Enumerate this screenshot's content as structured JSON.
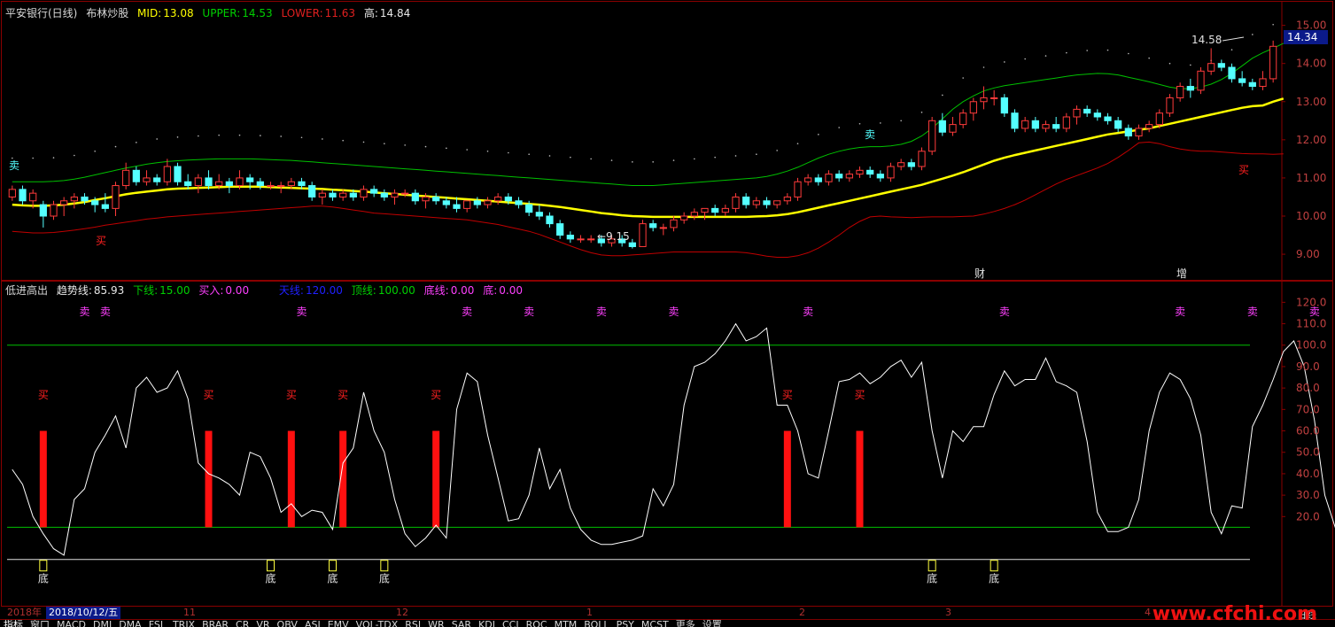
{
  "header_top": {
    "stock": "平安银行(日线)",
    "indicator": "布林炒股",
    "mid_label": "MID:",
    "mid": "13.08",
    "upper_label": "UPPER:",
    "upper": "14.53",
    "lower_label": "LOWER:",
    "lower": "11.63",
    "high_label": "高:",
    "high": "14.84"
  },
  "header_sub": {
    "indicator": "低进高出",
    "trend_label": "趋势线:",
    "trend": "85.93",
    "down_label": "下线:",
    "down": "15.00",
    "buy_label": "买入:",
    "buy": "0.00",
    "sky_label": "天线:",
    "sky": "120.00",
    "top_label": "顶线:",
    "top": "100.00",
    "floor_label": "底线:",
    "floor": "0.00",
    "bottom_label": "底:",
    "bottom": "0.00"
  },
  "price_axis": [
    "15.00",
    "14.00",
    "13.00",
    "12.00",
    "11.00",
    "10.00",
    "9.00"
  ],
  "osc_axis": [
    "120.0",
    "110.0",
    "100.0",
    "90.0",
    "80.0",
    "70.0",
    "60.0",
    "50.0",
    "40.0",
    "30.0",
    "20.0"
  ],
  "current_price": "14.34",
  "annotations": {
    "high_mark": "14.58",
    "low_mark": "9.15",
    "cai": "财",
    "zeng": "增"
  },
  "signal_labels": {
    "sell": "卖",
    "buy": "买",
    "bottom": "底"
  },
  "date_axis": {
    "year": "2018年",
    "cursor_date": "2018/10/12/五",
    "months": [
      "11",
      "12",
      "1",
      "2",
      "3",
      "4"
    ],
    "period": "日线"
  },
  "tabs": [
    "指标",
    "窗口",
    "MACD",
    "DMI",
    "DMA",
    "FSL",
    "TRIX",
    "BRAR",
    "CR",
    "VR",
    "OBV",
    "ASI",
    "EMV",
    "VOL-TDX",
    "RSI",
    "WR",
    "SAR",
    "KDJ",
    "CCI",
    "ROC",
    "MTM",
    "BOLL",
    "PSY",
    "MCST",
    "更多",
    "设置"
  ],
  "watermark": "www.cfchi.com",
  "colors": {
    "up": "#ff3b3b",
    "down": "#54ffff",
    "mid_line": "#ffff00",
    "upper_line": "#00c000",
    "lower_line": "#c00000",
    "osc_line": "#ffffff",
    "ref_line": "#00c000",
    "border": "#8a0000",
    "sell": "#ff40ff",
    "buy": "#ff2020"
  },
  "chart_data": {
    "type": "candlestick+line",
    "price_range": [
      8.7,
      15.2
    ],
    "osc_range": [
      -15,
      128
    ],
    "candles": [
      [
        10.5,
        10.8,
        10.4,
        10.7
      ],
      [
        10.7,
        10.8,
        10.3,
        10.4
      ],
      [
        10.4,
        10.7,
        10.2,
        10.6
      ],
      [
        10.3,
        10.4,
        9.7,
        10.0
      ],
      [
        10.0,
        10.4,
        9.9,
        10.3
      ],
      [
        10.3,
        10.5,
        10.0,
        10.4
      ],
      [
        10.4,
        10.6,
        10.2,
        10.5
      ],
      [
        10.5,
        10.6,
        10.3,
        10.4
      ],
      [
        10.4,
        10.5,
        10.1,
        10.3
      ],
      [
        10.3,
        10.6,
        10.1,
        10.2
      ],
      [
        10.2,
        10.9,
        10.0,
        10.8
      ],
      [
        10.8,
        11.4,
        10.7,
        11.2
      ],
      [
        11.2,
        11.3,
        10.8,
        10.9
      ],
      [
        10.9,
        11.2,
        10.8,
        11.0
      ],
      [
        11.0,
        11.1,
        10.8,
        10.9
      ],
      [
        10.9,
        11.5,
        10.8,
        11.3
      ],
      [
        11.3,
        11.4,
        10.8,
        10.9
      ],
      [
        10.9,
        11.1,
        10.7,
        10.8
      ],
      [
        10.8,
        11.1,
        10.6,
        11.0
      ],
      [
        11.0,
        11.2,
        10.7,
        10.8
      ],
      [
        10.8,
        11.1,
        10.7,
        10.9
      ],
      [
        10.9,
        11.0,
        10.6,
        10.8
      ],
      [
        10.8,
        11.2,
        10.7,
        11.0
      ],
      [
        11.0,
        11.1,
        10.7,
        10.9
      ],
      [
        10.9,
        11.0,
        10.7,
        10.8
      ],
      [
        10.8,
        10.9,
        10.7,
        10.8
      ],
      [
        10.8,
        10.9,
        10.6,
        10.8
      ],
      [
        10.8,
        11.0,
        10.7,
        10.9
      ],
      [
        10.9,
        11.0,
        10.7,
        10.8
      ],
      [
        10.8,
        10.9,
        10.4,
        10.5
      ],
      [
        10.5,
        10.7,
        10.3,
        10.6
      ],
      [
        10.6,
        10.7,
        10.4,
        10.5
      ],
      [
        10.5,
        10.7,
        10.4,
        10.6
      ],
      [
        10.6,
        10.7,
        10.4,
        10.5
      ],
      [
        10.5,
        10.8,
        10.4,
        10.7
      ],
      [
        10.7,
        10.8,
        10.5,
        10.6
      ],
      [
        10.6,
        10.7,
        10.4,
        10.5
      ],
      [
        10.5,
        10.7,
        10.3,
        10.6
      ],
      [
        10.6,
        10.7,
        10.5,
        10.6
      ],
      [
        10.6,
        10.7,
        10.3,
        10.4
      ],
      [
        10.4,
        10.6,
        10.2,
        10.5
      ],
      [
        10.5,
        10.6,
        10.3,
        10.4
      ],
      [
        10.4,
        10.5,
        10.2,
        10.3
      ],
      [
        10.3,
        10.5,
        10.1,
        10.2
      ],
      [
        10.2,
        10.4,
        10.1,
        10.4
      ],
      [
        10.4,
        10.5,
        10.2,
        10.3
      ],
      [
        10.3,
        10.5,
        10.2,
        10.4
      ],
      [
        10.4,
        10.6,
        10.3,
        10.5
      ],
      [
        10.5,
        10.6,
        10.3,
        10.4
      ],
      [
        10.4,
        10.5,
        10.2,
        10.3
      ],
      [
        10.3,
        10.4,
        10.0,
        10.1
      ],
      [
        10.1,
        10.3,
        9.9,
        10.0
      ],
      [
        10.0,
        10.1,
        9.7,
        9.8
      ],
      [
        9.8,
        9.9,
        9.4,
        9.5
      ],
      [
        9.5,
        9.6,
        9.3,
        9.4
      ],
      [
        9.4,
        9.5,
        9.3,
        9.4
      ],
      [
        9.4,
        9.5,
        9.3,
        9.4
      ],
      [
        9.4,
        9.5,
        9.2,
        9.3
      ],
      [
        9.3,
        9.5,
        9.2,
        9.4
      ],
      [
        9.4,
        9.5,
        9.2,
        9.3
      ],
      [
        9.3,
        9.4,
        9.15,
        9.2
      ],
      [
        9.2,
        9.9,
        9.2,
        9.8
      ],
      [
        9.8,
        9.9,
        9.6,
        9.7
      ],
      [
        9.7,
        9.8,
        9.5,
        9.7
      ],
      [
        9.7,
        10.0,
        9.6,
        9.9
      ],
      [
        9.9,
        10.1,
        9.8,
        10.0
      ],
      [
        10.0,
        10.2,
        9.9,
        10.1
      ],
      [
        10.1,
        10.2,
        9.9,
        10.2
      ],
      [
        10.2,
        10.3,
        10.0,
        10.1
      ],
      [
        10.1,
        10.3,
        10.0,
        10.2
      ],
      [
        10.2,
        10.6,
        10.1,
        10.5
      ],
      [
        10.5,
        10.6,
        10.2,
        10.3
      ],
      [
        10.3,
        10.5,
        10.2,
        10.4
      ],
      [
        10.4,
        10.5,
        10.2,
        10.3
      ],
      [
        10.3,
        10.4,
        10.2,
        10.4
      ],
      [
        10.4,
        10.6,
        10.3,
        10.5
      ],
      [
        10.5,
        11.0,
        10.4,
        10.9
      ],
      [
        10.9,
        11.1,
        10.8,
        11.0
      ],
      [
        11.0,
        11.1,
        10.8,
        10.9
      ],
      [
        10.9,
        11.2,
        10.8,
        11.1
      ],
      [
        11.1,
        11.2,
        10.9,
        11.0
      ],
      [
        11.0,
        11.2,
        10.9,
        11.1
      ],
      [
        11.1,
        11.3,
        11.0,
        11.2
      ],
      [
        11.2,
        11.3,
        11.0,
        11.1
      ],
      [
        11.1,
        11.2,
        10.9,
        11.0
      ],
      [
        11.0,
        11.4,
        10.9,
        11.3
      ],
      [
        11.3,
        11.5,
        11.2,
        11.4
      ],
      [
        11.4,
        11.5,
        11.2,
        11.3
      ],
      [
        11.3,
        11.8,
        11.2,
        11.7
      ],
      [
        11.7,
        12.6,
        11.6,
        12.5
      ],
      [
        12.5,
        12.7,
        12.1,
        12.2
      ],
      [
        12.2,
        12.6,
        12.1,
        12.4
      ],
      [
        12.4,
        12.8,
        12.3,
        12.7
      ],
      [
        12.7,
        13.1,
        12.5,
        13.0
      ],
      [
        13.0,
        13.4,
        12.8,
        13.1
      ],
      [
        13.1,
        13.3,
        12.9,
        13.1
      ],
      [
        13.1,
        13.2,
        12.6,
        12.7
      ],
      [
        12.7,
        12.8,
        12.2,
        12.3
      ],
      [
        12.3,
        12.6,
        12.2,
        12.5
      ],
      [
        12.5,
        12.6,
        12.2,
        12.3
      ],
      [
        12.3,
        12.5,
        12.2,
        12.4
      ],
      [
        12.4,
        12.6,
        12.2,
        12.3
      ],
      [
        12.3,
        12.7,
        12.2,
        12.6
      ],
      [
        12.6,
        12.9,
        12.4,
        12.8
      ],
      [
        12.8,
        12.9,
        12.6,
        12.7
      ],
      [
        12.7,
        12.8,
        12.5,
        12.6
      ],
      [
        12.6,
        12.7,
        12.4,
        12.5
      ],
      [
        12.5,
        12.6,
        12.2,
        12.3
      ],
      [
        12.3,
        12.4,
        12.0,
        12.1
      ],
      [
        12.1,
        12.4,
        12.0,
        12.3
      ],
      [
        12.3,
        12.5,
        12.2,
        12.4
      ],
      [
        12.4,
        12.8,
        12.3,
        12.7
      ],
      [
        12.7,
        13.2,
        12.6,
        13.1
      ],
      [
        13.1,
        13.5,
        13.0,
        13.4
      ],
      [
        13.4,
        13.6,
        13.1,
        13.3
      ],
      [
        13.3,
        13.9,
        13.2,
        13.8
      ],
      [
        13.8,
        14.4,
        13.7,
        14.0
      ],
      [
        14.0,
        14.1,
        13.8,
        13.9
      ],
      [
        13.9,
        14.0,
        13.5,
        13.6
      ],
      [
        13.6,
        13.8,
        13.4,
        13.5
      ],
      [
        13.5,
        13.6,
        13.3,
        13.4
      ],
      [
        13.4,
        13.8,
        13.3,
        13.6
      ],
      [
        13.6,
        14.6,
        13.5,
        14.45
      ]
    ],
    "mid": [
      10.3,
      10.28,
      10.27,
      10.27,
      10.28,
      10.3,
      10.33,
      10.37,
      10.42,
      10.47,
      10.52,
      10.57,
      10.61,
      10.64,
      10.67,
      10.7,
      10.72,
      10.73,
      10.74,
      10.75,
      10.76,
      10.77,
      10.77,
      10.77,
      10.77,
      10.76,
      10.75,
      10.74,
      10.73,
      10.72,
      10.71,
      10.69,
      10.68,
      10.66,
      10.64,
      10.62,
      10.6,
      10.58,
      10.56,
      10.54,
      10.52,
      10.5,
      10.48,
      10.46,
      10.44,
      10.42,
      10.4,
      10.38,
      10.36,
      10.34,
      10.32,
      10.3,
      10.27,
      10.24,
      10.2,
      10.16,
      10.12,
      10.08,
      10.05,
      10.02,
      10.0,
      9.99,
      9.98,
      9.98,
      9.98,
      9.98,
      9.98,
      9.98,
      9.98,
      9.98,
      9.98,
      9.98,
      9.99,
      10.0,
      10.02,
      10.05,
      10.1,
      10.16,
      10.22,
      10.28,
      10.34,
      10.4,
      10.46,
      10.52,
      10.58,
      10.64,
      10.7,
      10.76,
      10.82,
      10.9,
      10.98,
      11.06,
      11.15,
      11.25,
      11.35,
      11.45,
      11.53,
      11.6,
      11.66,
      11.72,
      11.78,
      11.84,
      11.9,
      11.96,
      12.02,
      12.08,
      12.14,
      12.18,
      12.22,
      12.26,
      12.3,
      12.36,
      12.42,
      12.48,
      12.54,
      12.6,
      12.66,
      12.72,
      12.78,
      12.84,
      12.88,
      12.9,
      13.0,
      13.08
    ],
    "upper": [
      10.9,
      10.9,
      10.9,
      10.9,
      10.91,
      10.93,
      10.97,
      11.02,
      11.08,
      11.14,
      11.2,
      11.26,
      11.31,
      11.36,
      11.4,
      11.43,
      11.45,
      11.47,
      11.48,
      11.49,
      11.5,
      11.5,
      11.5,
      11.5,
      11.49,
      11.48,
      11.47,
      11.46,
      11.44,
      11.42,
      11.4,
      11.38,
      11.36,
      11.34,
      11.32,
      11.3,
      11.28,
      11.26,
      11.24,
      11.22,
      11.2,
      11.18,
      11.16,
      11.14,
      11.12,
      11.1,
      11.08,
      11.06,
      11.04,
      11.02,
      11.0,
      10.98,
      10.96,
      10.94,
      10.92,
      10.9,
      10.88,
      10.86,
      10.84,
      10.82,
      10.8,
      10.8,
      10.8,
      10.82,
      10.84,
      10.86,
      10.88,
      10.9,
      10.92,
      10.94,
      10.96,
      10.98,
      11.0,
      11.04,
      11.1,
      11.18,
      11.28,
      11.4,
      11.52,
      11.62,
      11.7,
      11.76,
      11.8,
      11.82,
      11.82,
      11.84,
      11.88,
      11.96,
      12.1,
      12.3,
      12.55,
      12.8,
      13.0,
      13.15,
      13.28,
      13.36,
      13.42,
      13.46,
      13.5,
      13.54,
      13.58,
      13.62,
      13.66,
      13.7,
      13.72,
      13.74,
      13.73,
      13.7,
      13.64,
      13.58,
      13.52,
      13.45,
      13.38,
      13.34,
      13.34,
      13.38,
      13.46,
      13.58,
      13.74,
      13.94,
      14.14,
      14.28,
      14.4,
      14.53
    ],
    "lower": [
      9.6,
      9.58,
      9.56,
      9.56,
      9.57,
      9.6,
      9.63,
      9.67,
      9.71,
      9.76,
      9.8,
      9.84,
      9.88,
      9.92,
      9.95,
      9.98,
      10.0,
      10.02,
      10.04,
      10.06,
      10.08,
      10.1,
      10.12,
      10.14,
      10.16,
      10.18,
      10.2,
      10.22,
      10.24,
      10.26,
      10.26,
      10.24,
      10.2,
      10.16,
      10.12,
      10.08,
      10.06,
      10.04,
      10.02,
      10.0,
      9.98,
      9.96,
      9.94,
      9.92,
      9.9,
      9.86,
      9.82,
      9.78,
      9.72,
      9.66,
      9.6,
      9.52,
      9.42,
      9.32,
      9.22,
      9.12,
      9.04,
      8.98,
      8.96,
      8.96,
      8.98,
      9.0,
      9.02,
      9.04,
      9.06,
      9.06,
      9.06,
      9.06,
      9.06,
      9.06,
      9.06,
      9.04,
      9.0,
      8.95,
      8.92,
      8.92,
      8.96,
      9.04,
      9.16,
      9.32,
      9.5,
      9.7,
      9.86,
      9.98,
      10.0,
      9.98,
      9.97,
      9.96,
      9.97,
      9.98,
      9.98,
      9.98,
      9.99,
      10.0,
      10.05,
      10.12,
      10.2,
      10.3,
      10.42,
      10.56,
      10.7,
      10.84,
      10.96,
      11.06,
      11.16,
      11.26,
      11.38,
      11.54,
      11.72,
      11.92,
      11.94,
      11.9,
      11.82,
      11.76,
      11.72,
      11.7,
      11.7,
      11.68,
      11.66,
      11.64,
      11.63,
      11.63,
      11.62,
      11.63
    ],
    "osc": [
      42,
      35,
      20,
      12,
      5,
      2,
      28,
      33,
      50,
      58,
      67,
      52,
      80,
      85,
      78,
      80,
      88,
      75,
      45,
      40,
      38,
      35,
      30,
      50,
      48,
      38,
      22,
      26,
      20,
      23,
      22,
      14,
      45,
      52,
      78,
      60,
      50,
      28,
      12,
      6,
      10,
      16,
      10,
      70,
      87,
      83,
      58,
      38,
      18,
      19,
      30,
      52,
      33,
      42,
      24,
      14,
      9,
      7,
      7,
      8,
      9,
      11,
      33,
      25,
      35,
      72,
      90,
      92,
      96,
      102,
      110,
      102,
      104,
      108,
      72,
      72,
      60,
      40,
      38,
      60,
      83,
      84,
      87,
      82,
      85,
      90,
      93,
      85,
      92,
      60,
      38,
      60,
      55,
      62,
      62,
      77,
      88,
      81,
      84,
      84,
      94,
      83,
      81,
      78,
      55,
      22,
      13,
      13,
      15,
      28,
      60,
      78,
      87,
      84,
      75,
      58,
      22,
      12,
      25,
      24,
      62,
      72,
      84,
      97,
      102,
      90,
      65,
      30,
      15,
      30,
      70,
      86
    ],
    "sell_idx": [
      7,
      9,
      28,
      44,
      50,
      57,
      64,
      77,
      96,
      113,
      120,
      126
    ],
    "buy_idx": [
      3,
      19,
      27,
      32,
      41,
      75,
      82
    ],
    "bottom_idx": [
      3,
      25,
      31,
      36,
      89,
      95
    ]
  }
}
